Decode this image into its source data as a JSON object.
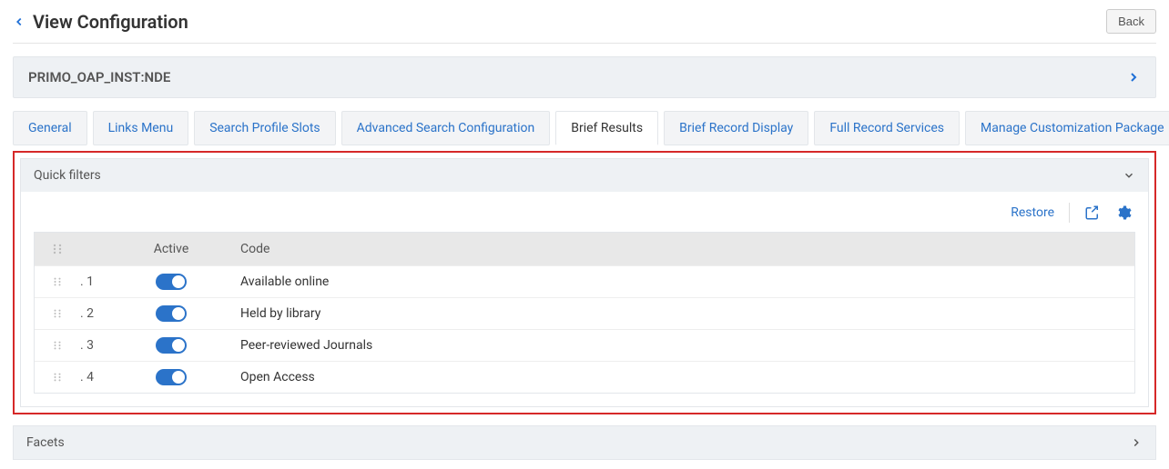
{
  "header": {
    "title": "View Configuration",
    "back_button": "Back"
  },
  "instance": {
    "label": "PRIMO_OAP_INST:NDE"
  },
  "tabs": [
    {
      "label": "General",
      "active": false
    },
    {
      "label": "Links Menu",
      "active": false
    },
    {
      "label": "Search Profile Slots",
      "active": false
    },
    {
      "label": "Advanced Search Configuration",
      "active": false
    },
    {
      "label": "Brief Results",
      "active": true
    },
    {
      "label": "Brief Record Display",
      "active": false
    },
    {
      "label": "Full Record Services",
      "active": false
    },
    {
      "label": "Manage Customization Package",
      "active": false
    }
  ],
  "quick_filters_panel": {
    "title": "Quick filters",
    "restore_label": "Restore",
    "columns": {
      "active": "Active",
      "code": "Code"
    },
    "rows": [
      {
        "idx": ". 1",
        "active": true,
        "code": "Available online"
      },
      {
        "idx": ". 2",
        "active": true,
        "code": "Held by library"
      },
      {
        "idx": ". 3",
        "active": true,
        "code": "Peer-reviewed Journals"
      },
      {
        "idx": ". 4",
        "active": true,
        "code": "Open Access"
      }
    ]
  },
  "facets_panel": {
    "title": "Facets"
  }
}
